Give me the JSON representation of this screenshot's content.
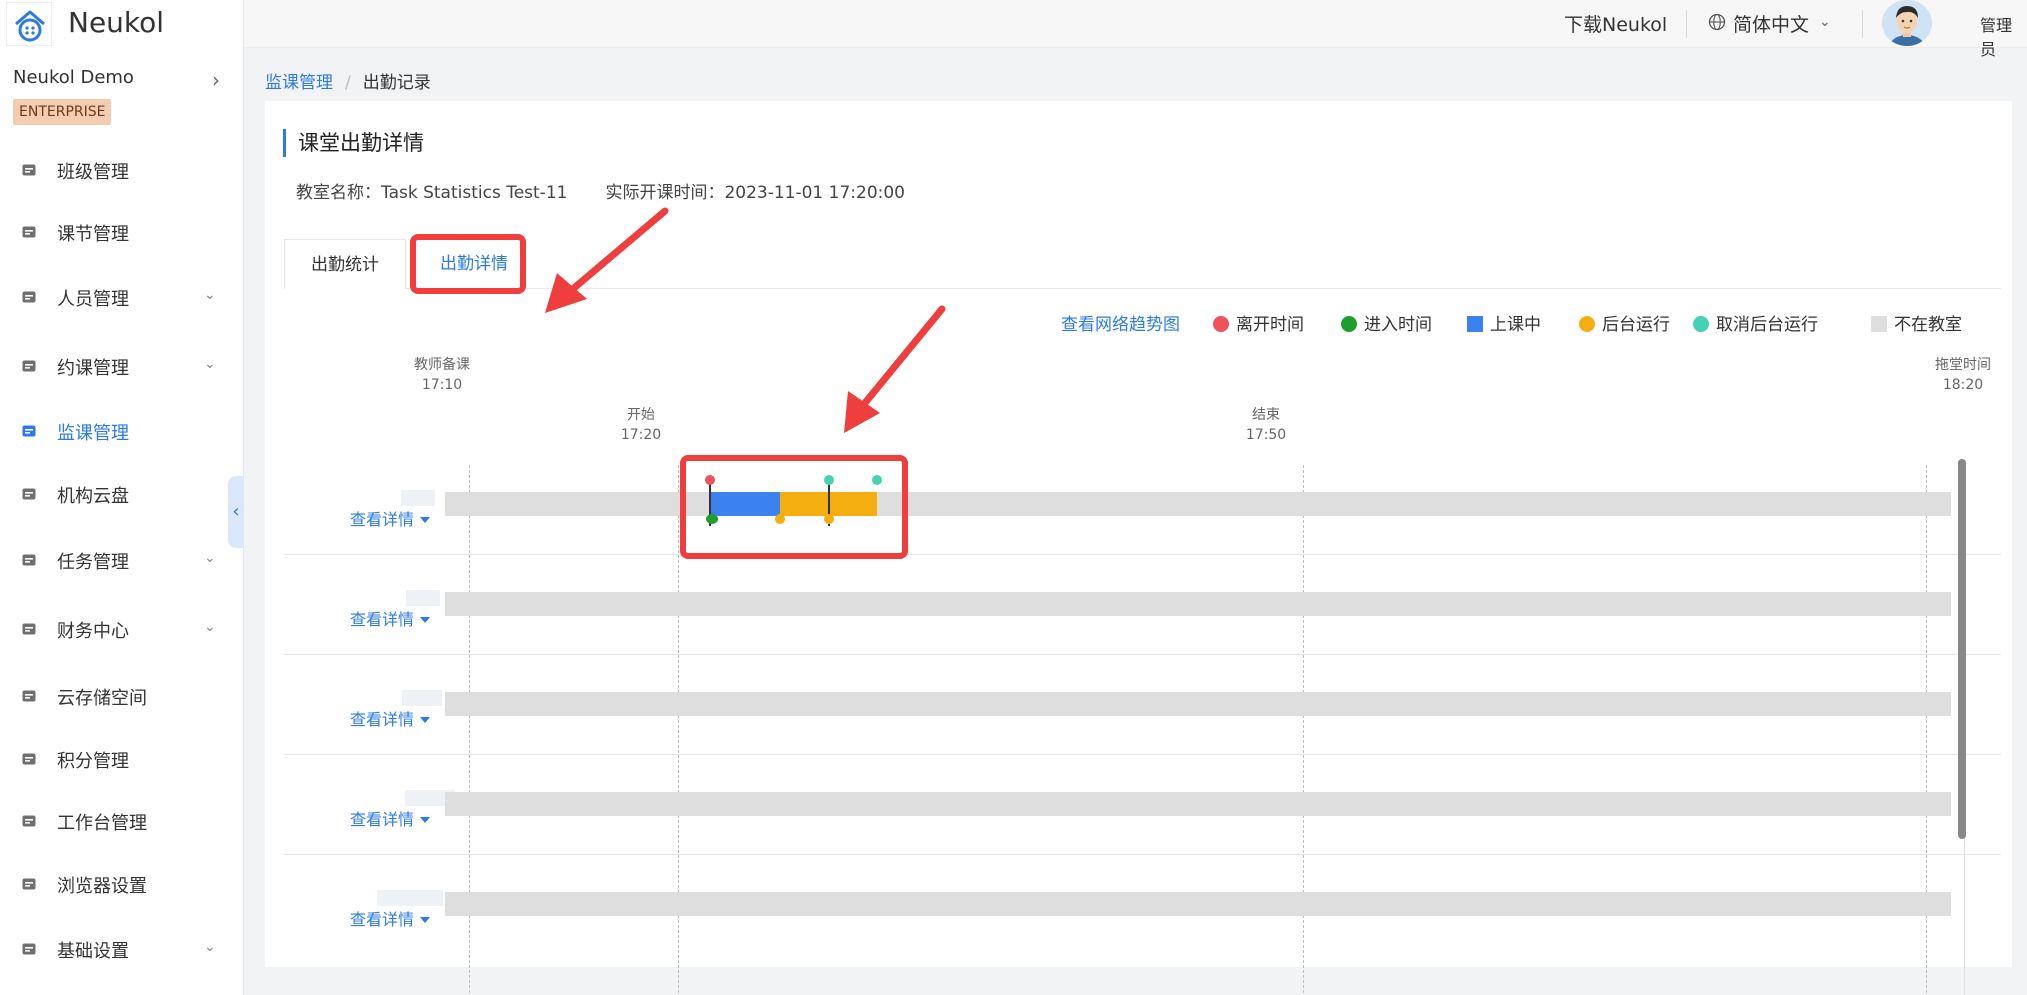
{
  "app": {
    "logo_text": "Neukol"
  },
  "org": {
    "name": "Neukol Demo",
    "badge": "ENTERPRISE"
  },
  "sidebar": {
    "items": [
      {
        "label": "班级管理",
        "icon": "class-icon",
        "has_children": false,
        "active": false
      },
      {
        "label": "课节管理",
        "icon": "lesson-icon",
        "has_children": false,
        "active": false
      },
      {
        "label": "人员管理",
        "icon": "people-icon",
        "has_children": true,
        "active": false
      },
      {
        "label": "约课管理",
        "icon": "booking-icon",
        "has_children": true,
        "active": false
      },
      {
        "label": "监课管理",
        "icon": "monitor-icon",
        "has_children": false,
        "active": true
      },
      {
        "label": "机构云盘",
        "icon": "cloud-icon",
        "has_children": false,
        "active": false
      },
      {
        "label": "任务管理",
        "icon": "task-icon",
        "has_children": true,
        "active": false
      },
      {
        "label": "财务中心",
        "icon": "finance-icon",
        "has_children": true,
        "active": false
      },
      {
        "label": "云存储空间",
        "icon": "storage-icon",
        "has_children": false,
        "active": false
      },
      {
        "label": "积分管理",
        "icon": "points-icon",
        "has_children": false,
        "active": false
      },
      {
        "label": "工作台管理",
        "icon": "workbench-icon",
        "has_children": false,
        "active": false
      },
      {
        "label": "浏览器设置",
        "icon": "browser-icon",
        "has_children": false,
        "active": false
      },
      {
        "label": "基础设置",
        "icon": "settings-icon",
        "has_children": true,
        "active": false
      }
    ]
  },
  "header": {
    "download": "下载Neukol",
    "language": "简体中文",
    "user": "管理员"
  },
  "breadcrumb": {
    "parent": "监课管理",
    "sep": "/",
    "current": "出勤记录"
  },
  "page": {
    "title": "课堂出勤详情",
    "classroom_label": "教室名称：Task Statistics Test-11",
    "start_label": "实际开课时间：2023-11-01 17:20:00"
  },
  "tabs": {
    "stat": "出勤统计",
    "detail": "出勤详情"
  },
  "legend": {
    "trend_link": "查看网络趋势图",
    "items": [
      {
        "label": "离开时间",
        "color": "#f0525a",
        "shape": "dot"
      },
      {
        "label": "进入时间",
        "color": "#1f9e2b",
        "shape": "dot"
      },
      {
        "label": "上课中",
        "color": "#3b82f0",
        "shape": "square"
      },
      {
        "label": "后台运行",
        "color": "#f5ae0f",
        "shape": "dot"
      },
      {
        "label": "取消后台运行",
        "color": "#44d2b4",
        "shape": "dot"
      },
      {
        "label": "不在教室",
        "color": "#dedede",
        "shape": "square"
      }
    ]
  },
  "timeline": {
    "prep": {
      "label": "教师备课",
      "time": "17:10"
    },
    "start": {
      "label": "开始",
      "time": "17:20"
    },
    "end": {
      "label": "结束",
      "time": "17:50"
    },
    "overtime": {
      "label": "拖堂时间",
      "time": "18:20"
    },
    "rows": [
      {
        "link": "查看详情"
      },
      {
        "link": "查看详情"
      },
      {
        "link": "查看详情"
      },
      {
        "link": "查看详情"
      },
      {
        "link": "查看详情"
      }
    ]
  }
}
